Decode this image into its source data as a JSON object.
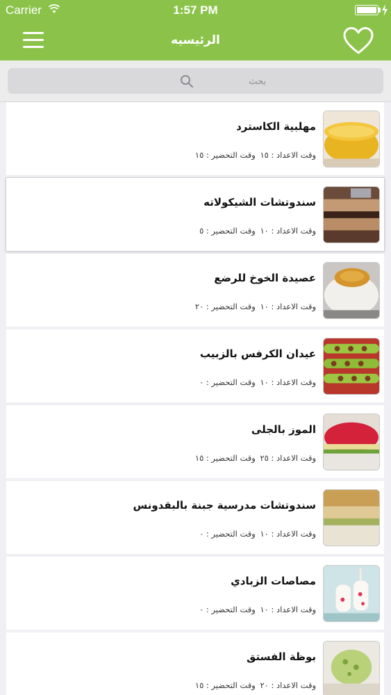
{
  "status_bar": {
    "carrier": "Carrier",
    "time": "1:57 PM"
  },
  "nav": {
    "title": "الرئيسيه",
    "menu_icon": "hamburger-icon",
    "favorite_icon": "heart-icon"
  },
  "search": {
    "placeholder": "بحث",
    "icon": "search-icon"
  },
  "colors": {
    "accent": "#8bc34a",
    "background": "#efeff4"
  },
  "recipes": [
    {
      "title": "مهلبية الكاسترد",
      "prep_label": "وقت الاعداد : ١٥",
      "cook_label": "وقت التحضير : ١٥",
      "image": "custard-pudding"
    },
    {
      "title": "سندوتشات الشيكولاته",
      "prep_label": "وقت الاعداد : ١٠",
      "cook_label": "وقت التحضير : ٥",
      "image": "chocolate-sandwiches"
    },
    {
      "title": "عصيدة الخوخ للرضع",
      "prep_label": "وقت الاعداد : ١٠",
      "cook_label": "وقت التحضير : ٢٠",
      "image": "peach-porridge"
    },
    {
      "title": "عيدان الكرفس بالزبيب",
      "prep_label": "وقت الاعداد : ١٠",
      "cook_label": "وقت التحضير : ٠",
      "image": "celery-raisins"
    },
    {
      "title": "الموز بالجلى",
      "prep_label": "وقت الاعداد : ٢٥",
      "cook_label": "وقت التحضير : ١٥",
      "image": "banana-jelly"
    },
    {
      "title": "سندوتشات مدرسية جبنة بالبقدونس",
      "prep_label": "وقت الاعداد : ١٠",
      "cook_label": "وقت التحضير : ٠",
      "image": "cheese-parsley-sandwiches"
    },
    {
      "title": "مصاصات الزبادي",
      "prep_label": "وقت الاعداد : ١٠",
      "cook_label": "وقت التحضير : ٠",
      "image": "yogurt-popsicles"
    },
    {
      "title": "بوظة الفستق",
      "prep_label": "وقت الاعداد : ٢٠",
      "cook_label": "وقت التحضير : ١٥",
      "image": "pistachio-ice-cream"
    }
  ]
}
